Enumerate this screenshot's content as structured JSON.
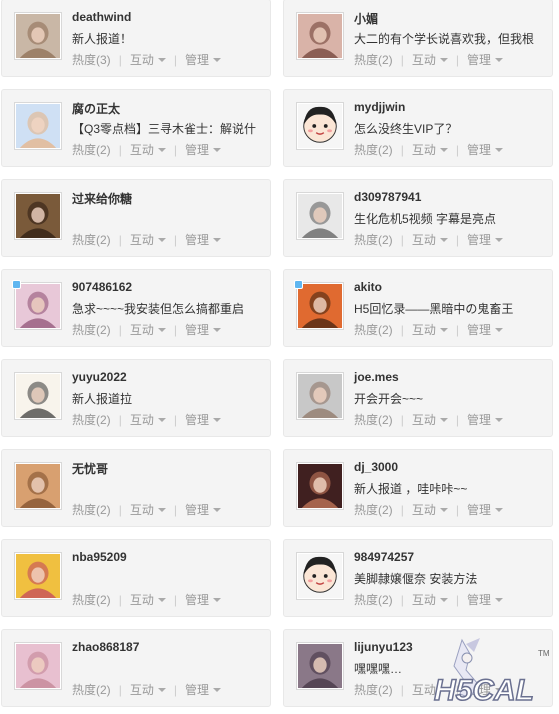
{
  "labels": {
    "heat_prefix": "热度",
    "interact": "互动",
    "manage": "管理"
  },
  "users": [
    {
      "name": "deathwind",
      "status": "新人报道！",
      "heat": "(3)",
      "avatar": "baby-photo",
      "badge": false
    },
    {
      "name": "小媚",
      "status": "大二的有个学长说喜欢我，但我根",
      "heat": "(2)",
      "avatar": "girl-photo",
      "badge": false
    },
    {
      "name": "腐の正太",
      "status": "【Q3零点档】三寻木雀士：解说什",
      "heat": "(2)",
      "avatar": "anime-girl",
      "badge": false
    },
    {
      "name": "mydjjwin",
      "status": "怎么没终生VIP了？",
      "heat": "(2)",
      "avatar": "default-avatar",
      "badge": false
    },
    {
      "name": "过来给你糖",
      "status": "",
      "heat": "(2)",
      "avatar": "anime-dark",
      "badge": false
    },
    {
      "name": "d309787941",
      "status": "生化危机5视频 字幕是亮点",
      "heat": "(2)",
      "avatar": "manga-sketch",
      "badge": false
    },
    {
      "name": "907486162",
      "status": "急求~~~~我安装但怎么搞都重启",
      "heat": "(2)",
      "avatar": "anime-pink",
      "badge": true
    },
    {
      "name": "akito",
      "status": "H5回忆录——黑暗中の鬼畜王",
      "heat": "(2)",
      "avatar": "anime-boy",
      "badge": true
    },
    {
      "name": "yuyu2022",
      "status": "新人报道拉",
      "heat": "(2)",
      "avatar": "chibi-drawing",
      "badge": false
    },
    {
      "name": "joe.mes",
      "status": "开会开会~~~",
      "heat": "(2)",
      "avatar": "child-photo",
      "badge": false
    },
    {
      "name": "无忧哥",
      "status": "",
      "heat": "(2)",
      "avatar": "anime-brown",
      "badge": false
    },
    {
      "name": "dj_3000",
      "status": "新人报道 ，哇咔咔~~",
      "heat": "(2)",
      "avatar": "poster-photo",
      "badge": false
    },
    {
      "name": "nba95209",
      "status": "",
      "heat": "(2)",
      "avatar": "anime-colorful",
      "badge": false
    },
    {
      "name": "984974257",
      "status": "美脚隷嬢偃奈 安装方法",
      "heat": "(2)",
      "avatar": "default-avatar",
      "badge": false
    },
    {
      "name": "zhao868187",
      "status": "",
      "heat": "(2)",
      "avatar": "pink-photo",
      "badge": false
    },
    {
      "name": "lijunyu123",
      "status": "嘿嘿嘿…",
      "heat": "(2)",
      "avatar": "dark-photo",
      "badge": false
    }
  ],
  "watermark": {
    "logo_text": "H5CAL",
    "tm": "TM"
  }
}
